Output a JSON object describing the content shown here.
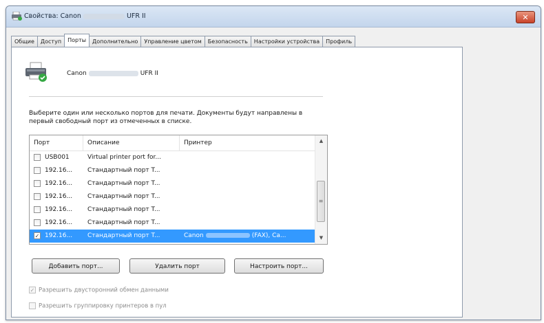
{
  "window": {
    "title_prefix": "Свойства: Canon",
    "title_suffix": "UFR II",
    "close_glyph": "✕"
  },
  "tabs": [
    {
      "label": "Общие",
      "active": false
    },
    {
      "label": "Доступ",
      "active": false
    },
    {
      "label": "Порты",
      "active": true
    },
    {
      "label": "Дополнительно",
      "active": false
    },
    {
      "label": "Управление цветом",
      "active": false
    },
    {
      "label": "Безопасность",
      "active": false
    },
    {
      "label": "Настройки устройства",
      "active": false
    },
    {
      "label": "Профиль",
      "active": false
    }
  ],
  "printer": {
    "name_prefix": "Canon",
    "name_suffix": "UFR II",
    "icon": "printer-icon"
  },
  "instructions": "Выберите один или несколько портов для печати. Документы будут направлены в первый свободный порт из отмеченных в списке.",
  "ports_table": {
    "headers": {
      "port": "Порт",
      "description": "Описание",
      "printer": "Принтер"
    },
    "rows": [
      {
        "port": "USB001",
        "description": "Virtual printer port for...",
        "printer": "",
        "checked": false,
        "selected": false
      },
      {
        "port": "192.16...",
        "description": "Стандартный порт T...",
        "printer": "",
        "checked": false,
        "selected": false
      },
      {
        "port": "192.16...",
        "description": "Стандартный порт T...",
        "printer": "",
        "checked": false,
        "selected": false
      },
      {
        "port": "192.16...",
        "description": "Стандартный порт T...",
        "printer": "",
        "checked": false,
        "selected": false
      },
      {
        "port": "192.16...",
        "description": "Стандартный порт T...",
        "printer": "",
        "checked": false,
        "selected": false
      },
      {
        "port": "192.16...",
        "description": "Стандартный порт T...",
        "printer": "",
        "checked": false,
        "selected": false
      },
      {
        "port": "192.16...",
        "description": "Стандартный порт T...",
        "printer_prefix": "Canon",
        "printer_suffix": "(FAX), Ca...",
        "checked": true,
        "selected": true
      }
    ],
    "scroll_up_glyph": "▲",
    "scroll_down_glyph": "▼",
    "scroll_grip_glyph": "≡"
  },
  "buttons": {
    "add_port": "Добавить порт...",
    "delete_port": "Удалить порт",
    "configure_port": "Настроить порт..."
  },
  "options": {
    "bidirectional": {
      "label": "Разрешить двусторонний обмен данными",
      "checked": true,
      "enabled": false
    },
    "pooling": {
      "label": "Разрешить группировку принтеров в пул",
      "checked": false,
      "enabled": false
    }
  },
  "check_glyph": "✓"
}
